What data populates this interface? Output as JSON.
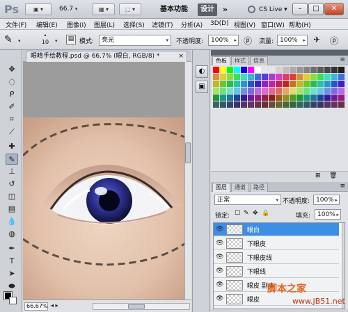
{
  "app": {
    "logo": "Ps",
    "zoom": "66.7",
    "workspace_basic": "基本功能",
    "workspace_design": "设计",
    "more": "»",
    "cslive": "CS Live"
  },
  "menu": [
    "文件(F)",
    "编辑(E)",
    "图像(I)",
    "图层(L)",
    "选择(S)",
    "滤镜(T)",
    "分析(A)",
    "3D(D)",
    "视图(V)",
    "窗口(W)",
    "帮助(H)"
  ],
  "options": {
    "brush_size": "10",
    "mode_label": "模式:",
    "mode_value": "亮光",
    "opacity_label": "不透明度:",
    "opacity_value": "100%",
    "flow_label": "流量:",
    "flow_value": "100%"
  },
  "document": {
    "tab_title": "眼睛手绘教程.psd @ 66.7% (眼白, RGB/8) *",
    "zoom_status": "66.67%"
  },
  "swatch_panel": {
    "tabs": [
      "色板",
      "样式",
      "信息"
    ]
  },
  "layers_panel": {
    "tabs": [
      "图层",
      "通道",
      "路径"
    ],
    "blend_mode": "正常",
    "opacity_label": "不透明度:",
    "opacity_value": "100%",
    "lock_label": "锁定:",
    "fill_label": "填充:",
    "fill_value": "100%",
    "layers": [
      {
        "name": "眼白",
        "selected": true
      },
      {
        "name": "下眼皮",
        "selected": false
      },
      {
        "name": "下眼皮线",
        "selected": false
      },
      {
        "name": "下眼线",
        "selected": false
      },
      {
        "name": "眼皮 副本",
        "selected": false
      },
      {
        "name": "眼皮",
        "selected": false
      }
    ]
  },
  "watermark": {
    "line1": "脚本之家",
    "line2": "www.JB51.net"
  },
  "colors": {
    "selected_layer": "#3e8ee6",
    "iris": "#2b2f8c",
    "skin": "#e8cdb8"
  }
}
